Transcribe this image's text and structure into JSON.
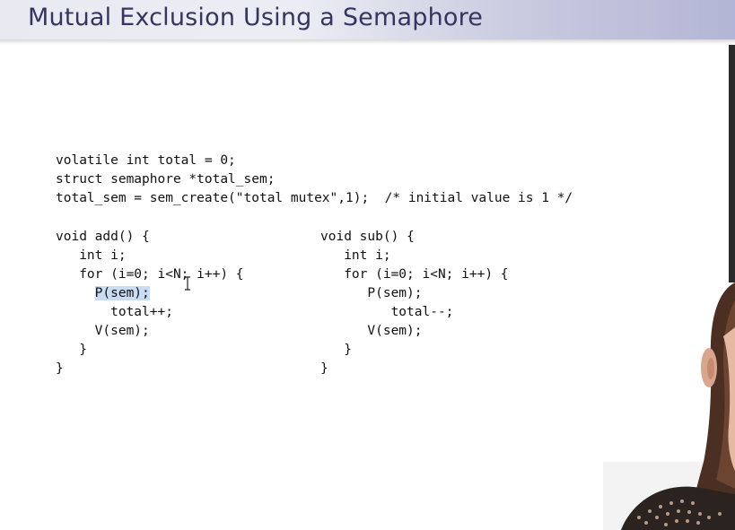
{
  "slide": {
    "title": "Mutual Exclusion Using a Semaphore"
  },
  "code_top": [
    "volatile int total = 0;",
    "struct semaphore *total_sem;",
    "total_sem = sem_create(\"total mutex\",1);  /* initial value is 1 */"
  ],
  "code_add": {
    "l0": "void add() {",
    "l1": "   int i;",
    "l2": "   for (i=0; i<N; i++) {",
    "l3_indent": "     ",
    "l3_highlight": "P(sem);",
    "l4": "       total++;",
    "l5": "     V(sem);",
    "l6": "   }",
    "l7": "}"
  },
  "code_sub": [
    "void sub() {",
    "   int i;",
    "   for (i=0; i<N; i++) {",
    "      P(sem);",
    "         total--;",
    "      V(sem);",
    "   }",
    "}"
  ],
  "cursor": {
    "icon": "text-cursor-icon"
  },
  "presenter": {
    "icon": "presenter-video-thumbnail"
  }
}
